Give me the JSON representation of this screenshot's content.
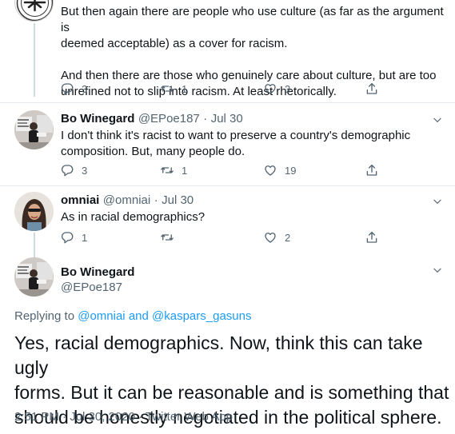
{
  "tweet0": {
    "lines": [
      "But then again there are people who use culture (as far as the argument is",
      "deemed acceptable) as a cover for racism.",
      "",
      "And then there are those who genuinely care about culture, but are too",
      "unrefined not to slip into racism. At least rhetorically."
    ],
    "replies": "3",
    "retweets": "1",
    "likes": "3"
  },
  "tweet1": {
    "name": "Bo Winegard",
    "handle": "@EPoe187",
    "dot": "·",
    "date": "Jul 30",
    "lines": [
      "I don't think it's racist to want to preserve a country's demographic",
      "composition. But, many people do."
    ],
    "replies": "3",
    "retweets": "1",
    "likes": "19"
  },
  "tweet2": {
    "name": "omniai",
    "handle": "@omniai",
    "dot": "·",
    "date": "Jul 30",
    "lines": [
      "As in racial demographics?"
    ],
    "replies": "1",
    "likes": "2"
  },
  "main": {
    "name": "Bo Winegard",
    "handle": "@EPoe187",
    "replying_prefix": "Replying to",
    "reply_user1": "@omniai",
    "reply_and": "and",
    "reply_user2": "@kaspars_gasuns",
    "lines": [
      "Yes, racial demographics. Now, think this can take ugly",
      "forms. But it can be reasonable and is something that",
      "should be honestly negotiated in the political sphere."
    ],
    "timestamp": "2:51 PM · Jul 30, 2020 · Twitter Web App"
  },
  "colors": {
    "accent": "#1d9bf0",
    "muted": "#536471",
    "text": "#0f1419",
    "thread_line": "#cfd9de"
  }
}
